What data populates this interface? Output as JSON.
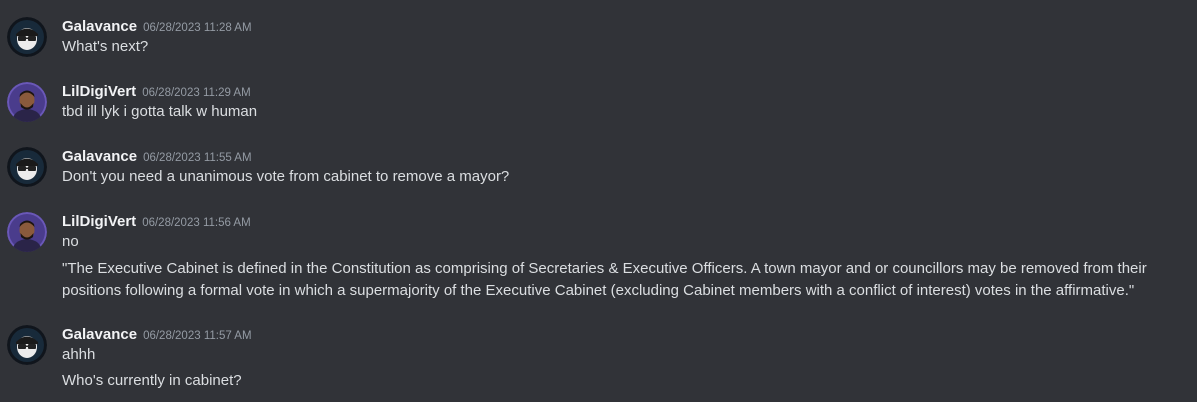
{
  "messages": [
    {
      "author": "Galavance",
      "avatar_icon": "galavance-avatar-icon",
      "timestamp": "06/28/2023 11:28 AM",
      "lines": [
        "What's next?"
      ]
    },
    {
      "author": "LilDigiVert",
      "avatar_icon": "lildigivert-avatar-icon",
      "timestamp": "06/28/2023 11:29 AM",
      "lines": [
        "tbd ill lyk i gotta talk w human"
      ]
    },
    {
      "author": "Galavance",
      "avatar_icon": "galavance-avatar-icon",
      "timestamp": "06/28/2023 11:55 AM",
      "lines": [
        "Don't you need a unanimous vote from cabinet to remove a mayor?"
      ]
    },
    {
      "author": "LilDigiVert",
      "avatar_icon": "lildigivert-avatar-icon",
      "timestamp": "06/28/2023 11:56 AM",
      "lines": [
        "no",
        "\"The Executive Cabinet is defined in the Constitution as comprising of Secretaries & Executive Officers. A town mayor and or councillors may be removed from their positions following a formal vote in which a supermajority of the Executive Cabinet (excluding Cabinet members with a conflict of interest) votes in the affirmative.\""
      ]
    },
    {
      "author": "Galavance",
      "avatar_icon": "galavance-avatar-icon",
      "timestamp": "06/28/2023 11:57 AM",
      "lines": [
        "ahhh",
        "Who's currently in cabinet?"
      ]
    }
  ],
  "colors": {
    "background": "#313338",
    "username": "#f2f3f5",
    "timestamp": "#949ba4",
    "message_text": "#dbdee1"
  }
}
